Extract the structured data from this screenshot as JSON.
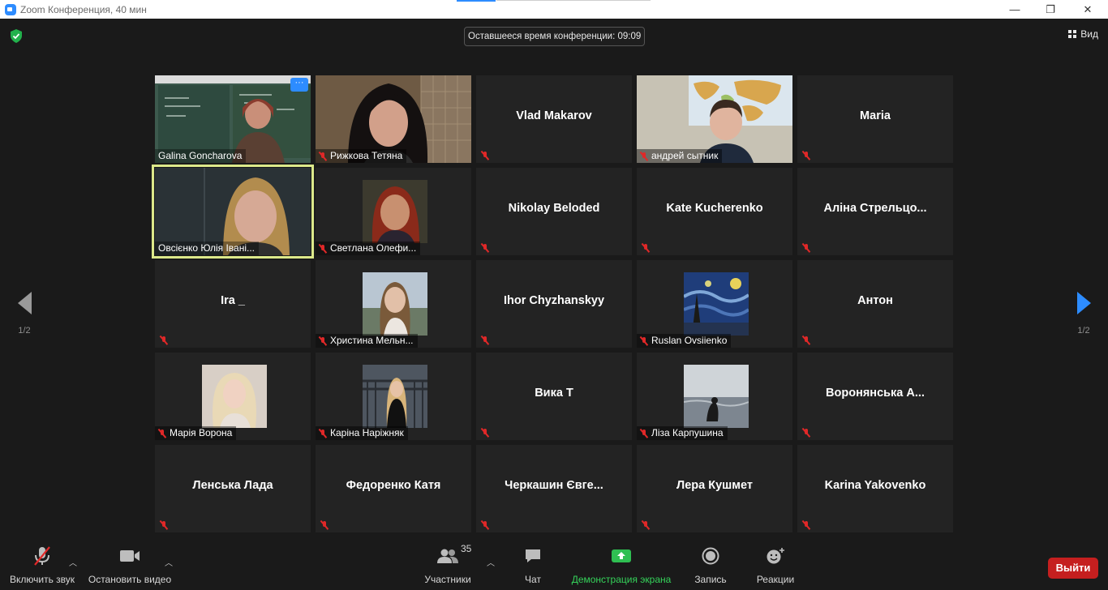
{
  "window": {
    "title": "Zoom Конференция, 40 мин",
    "minimize": "—",
    "restore": "❐",
    "close": "✕"
  },
  "header": {
    "timer_text": "Оставшееся время конференции: 09:09",
    "view_label": "Вид"
  },
  "pager": {
    "left_label": "1/2",
    "right_label": "1/2"
  },
  "participants": [
    {
      "name": "Galina Goncharova",
      "video": "classroom",
      "muted": false
    },
    {
      "name": "Рижкова Тетяна",
      "video": "woman-dark-hair",
      "muted": true
    },
    {
      "name": "Vlad Makarov",
      "video": null,
      "muted": true
    },
    {
      "name": "андрей сытник",
      "video": "boy-map",
      "muted": true
    },
    {
      "name": "Maria",
      "video": null,
      "muted": true
    },
    {
      "name": "Овсієнко Юлія Івані...",
      "video": "woman-blonde",
      "muted": false
    },
    {
      "name": "Светлана Олефи...",
      "video": "photo-woman-red",
      "muted": true
    },
    {
      "name": "Nikolay Beloded",
      "video": null,
      "muted": true
    },
    {
      "name": "Kate Kucherenko",
      "video": null,
      "muted": true
    },
    {
      "name": "Аліна  Стрельцо...",
      "video": null,
      "muted": true
    },
    {
      "name": "Ira _",
      "video": null,
      "muted": true
    },
    {
      "name": "Христина Мельн...",
      "video": "photo-girl-sky",
      "muted": true
    },
    {
      "name": "Ihor Chyzhanskyy",
      "video": null,
      "muted": true
    },
    {
      "name": "Ruslan Ovsiienko",
      "video": "photo-starry-night",
      "muted": true
    },
    {
      "name": "Антон",
      "video": null,
      "muted": true
    },
    {
      "name": "Марія Ворона",
      "video": "photo-blonde-girl",
      "muted": true
    },
    {
      "name": "Каріна Наріжняк",
      "video": "photo-girl-street",
      "muted": true
    },
    {
      "name": "Вика Т",
      "video": null,
      "muted": true
    },
    {
      "name": "Ліза Карпушина",
      "video": "photo-sea",
      "muted": true
    },
    {
      "name": "Воронянська  А...",
      "video": null,
      "muted": true
    },
    {
      "name": "Ленська Лада",
      "video": null,
      "muted": true
    },
    {
      "name": "Федоренко Катя",
      "video": null,
      "muted": true
    },
    {
      "name": "Черкашин Євге...",
      "video": null,
      "muted": true
    },
    {
      "name": "Лера Кушмет",
      "video": null,
      "muted": true
    },
    {
      "name": "Karina Yakovenko",
      "video": null,
      "muted": true
    }
  ],
  "toolbar": {
    "audio_label": "Включить звук",
    "video_label": "Остановить видео",
    "participants_label": "Участники",
    "participants_count": "35",
    "chat_label": "Чат",
    "share_label": "Демонстрация экрана",
    "record_label": "Запись",
    "reactions_label": "Реакции",
    "leave_label": "Выйти"
  },
  "colors": {
    "accent": "#2d8cff",
    "share_green": "#35d35a",
    "leave_red": "#c51f1f",
    "active_speaker": "#dce98a",
    "muted_red": "#e02828"
  }
}
